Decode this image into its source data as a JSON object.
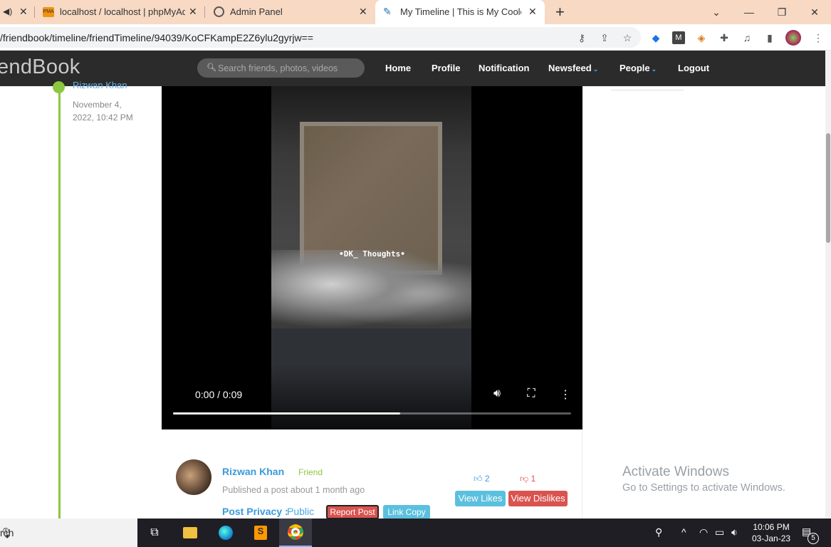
{
  "browser": {
    "tabs": [
      {
        "title": "",
        "icon": "speaker-icon",
        "active": false
      },
      {
        "title": "localhost / localhost | phpMyAdmin",
        "icon": "phpmyadmin-icon",
        "active": false
      },
      {
        "title": "Admin Panel",
        "icon": "globe-icon",
        "active": false
      },
      {
        "title": "My Timeline | This is My Coolest",
        "icon": "feather-icon",
        "active": true
      }
    ],
    "new_tab_label": "+",
    "url": "/friendbook/timeline/friendTimeline/94039/KoCFKampE2Z6ylu2gyrjw==",
    "accent": "#f7d9c4"
  },
  "navbar": {
    "logo": "endBook",
    "search_placeholder": "Search friends, photos, videos",
    "links": {
      "home": "Home",
      "profile": "Profile",
      "notification": "Notification",
      "newsfeed": "Newsfeed",
      "people": "People",
      "logout": "Logout"
    },
    "dropdown_chevron": "⌄"
  },
  "timeline": {
    "author": "Rizwan Khan",
    "date": "November 4, 2022, 10:42 PM",
    "accent": "#8dc63f"
  },
  "video": {
    "watermark": "•DK_ Thoughts•",
    "time": "0:00 / 0:09",
    "progress": 0.57
  },
  "post": {
    "author": "Rizwan Khan",
    "relation": "Friend",
    "meta": "Published a post about 1 month ago",
    "privacy_label": "Post Privacy :",
    "privacy_value": "Public",
    "report_label": "Report Post",
    "link_copy_label": "Link Copy",
    "likes": "2",
    "dislikes": "1",
    "view_likes_label": "View Likes",
    "view_dislikes_label": "View Dislikes"
  },
  "watermark": {
    "line1": "Activate Windows",
    "line2": "Go to Settings to activate Windows."
  },
  "taskbar": {
    "search_text": "rch",
    "time": "10:06 PM",
    "date": "03-Jan-23",
    "notification_count": "5"
  }
}
